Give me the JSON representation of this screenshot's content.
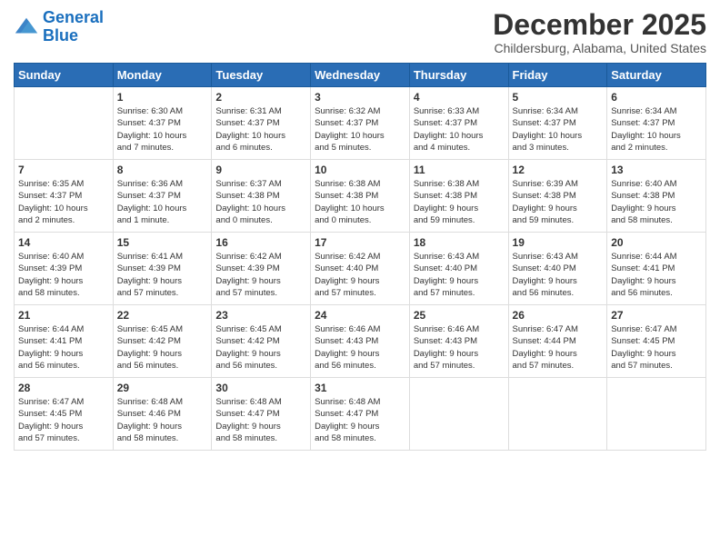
{
  "header": {
    "logo_line1": "General",
    "logo_line2": "Blue",
    "title": "December 2025",
    "subtitle": "Childersburg, Alabama, United States"
  },
  "days_of_week": [
    "Sunday",
    "Monday",
    "Tuesday",
    "Wednesday",
    "Thursday",
    "Friday",
    "Saturday"
  ],
  "weeks": [
    [
      {
        "day": "",
        "info": ""
      },
      {
        "day": "1",
        "info": "Sunrise: 6:30 AM\nSunset: 4:37 PM\nDaylight: 10 hours\nand 7 minutes."
      },
      {
        "day": "2",
        "info": "Sunrise: 6:31 AM\nSunset: 4:37 PM\nDaylight: 10 hours\nand 6 minutes."
      },
      {
        "day": "3",
        "info": "Sunrise: 6:32 AM\nSunset: 4:37 PM\nDaylight: 10 hours\nand 5 minutes."
      },
      {
        "day": "4",
        "info": "Sunrise: 6:33 AM\nSunset: 4:37 PM\nDaylight: 10 hours\nand 4 minutes."
      },
      {
        "day": "5",
        "info": "Sunrise: 6:34 AM\nSunset: 4:37 PM\nDaylight: 10 hours\nand 3 minutes."
      },
      {
        "day": "6",
        "info": "Sunrise: 6:34 AM\nSunset: 4:37 PM\nDaylight: 10 hours\nand 2 minutes."
      }
    ],
    [
      {
        "day": "7",
        "info": "Sunrise: 6:35 AM\nSunset: 4:37 PM\nDaylight: 10 hours\nand 2 minutes."
      },
      {
        "day": "8",
        "info": "Sunrise: 6:36 AM\nSunset: 4:37 PM\nDaylight: 10 hours\nand 1 minute."
      },
      {
        "day": "9",
        "info": "Sunrise: 6:37 AM\nSunset: 4:38 PM\nDaylight: 10 hours\nand 0 minutes."
      },
      {
        "day": "10",
        "info": "Sunrise: 6:38 AM\nSunset: 4:38 PM\nDaylight: 10 hours\nand 0 minutes."
      },
      {
        "day": "11",
        "info": "Sunrise: 6:38 AM\nSunset: 4:38 PM\nDaylight: 9 hours\nand 59 minutes."
      },
      {
        "day": "12",
        "info": "Sunrise: 6:39 AM\nSunset: 4:38 PM\nDaylight: 9 hours\nand 59 minutes."
      },
      {
        "day": "13",
        "info": "Sunrise: 6:40 AM\nSunset: 4:38 PM\nDaylight: 9 hours\nand 58 minutes."
      }
    ],
    [
      {
        "day": "14",
        "info": "Sunrise: 6:40 AM\nSunset: 4:39 PM\nDaylight: 9 hours\nand 58 minutes."
      },
      {
        "day": "15",
        "info": "Sunrise: 6:41 AM\nSunset: 4:39 PM\nDaylight: 9 hours\nand 57 minutes."
      },
      {
        "day": "16",
        "info": "Sunrise: 6:42 AM\nSunset: 4:39 PM\nDaylight: 9 hours\nand 57 minutes."
      },
      {
        "day": "17",
        "info": "Sunrise: 6:42 AM\nSunset: 4:40 PM\nDaylight: 9 hours\nand 57 minutes."
      },
      {
        "day": "18",
        "info": "Sunrise: 6:43 AM\nSunset: 4:40 PM\nDaylight: 9 hours\nand 57 minutes."
      },
      {
        "day": "19",
        "info": "Sunrise: 6:43 AM\nSunset: 4:40 PM\nDaylight: 9 hours\nand 56 minutes."
      },
      {
        "day": "20",
        "info": "Sunrise: 6:44 AM\nSunset: 4:41 PM\nDaylight: 9 hours\nand 56 minutes."
      }
    ],
    [
      {
        "day": "21",
        "info": "Sunrise: 6:44 AM\nSunset: 4:41 PM\nDaylight: 9 hours\nand 56 minutes."
      },
      {
        "day": "22",
        "info": "Sunrise: 6:45 AM\nSunset: 4:42 PM\nDaylight: 9 hours\nand 56 minutes."
      },
      {
        "day": "23",
        "info": "Sunrise: 6:45 AM\nSunset: 4:42 PM\nDaylight: 9 hours\nand 56 minutes."
      },
      {
        "day": "24",
        "info": "Sunrise: 6:46 AM\nSunset: 4:43 PM\nDaylight: 9 hours\nand 56 minutes."
      },
      {
        "day": "25",
        "info": "Sunrise: 6:46 AM\nSunset: 4:43 PM\nDaylight: 9 hours\nand 57 minutes."
      },
      {
        "day": "26",
        "info": "Sunrise: 6:47 AM\nSunset: 4:44 PM\nDaylight: 9 hours\nand 57 minutes."
      },
      {
        "day": "27",
        "info": "Sunrise: 6:47 AM\nSunset: 4:45 PM\nDaylight: 9 hours\nand 57 minutes."
      }
    ],
    [
      {
        "day": "28",
        "info": "Sunrise: 6:47 AM\nSunset: 4:45 PM\nDaylight: 9 hours\nand 57 minutes."
      },
      {
        "day": "29",
        "info": "Sunrise: 6:48 AM\nSunset: 4:46 PM\nDaylight: 9 hours\nand 58 minutes."
      },
      {
        "day": "30",
        "info": "Sunrise: 6:48 AM\nSunset: 4:47 PM\nDaylight: 9 hours\nand 58 minutes."
      },
      {
        "day": "31",
        "info": "Sunrise: 6:48 AM\nSunset: 4:47 PM\nDaylight: 9 hours\nand 58 minutes."
      },
      {
        "day": "",
        "info": ""
      },
      {
        "day": "",
        "info": ""
      },
      {
        "day": "",
        "info": ""
      }
    ]
  ]
}
